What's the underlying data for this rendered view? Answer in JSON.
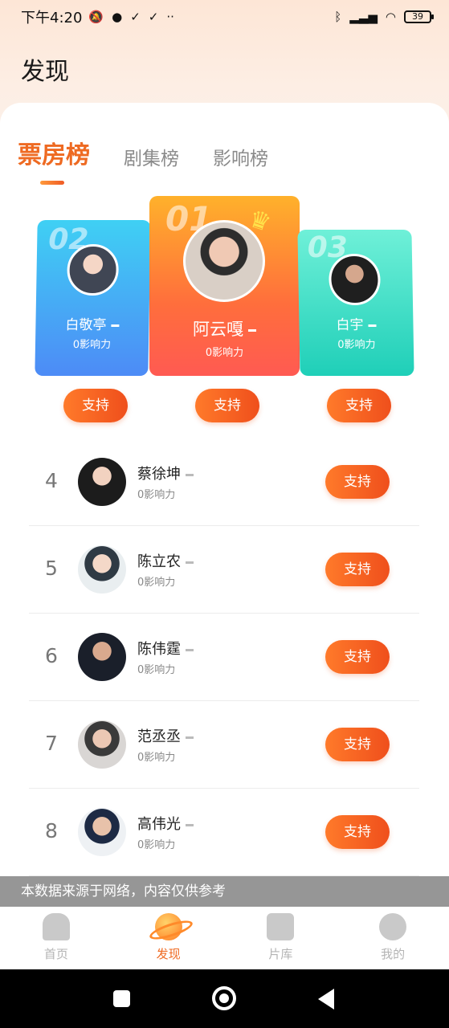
{
  "status_bar": {
    "time": "下午4:20",
    "battery": "39",
    "left_icons": [
      "mute-icon",
      "chat-icon",
      "check-icon",
      "check-icon",
      "more-icon"
    ],
    "right_icons": [
      "bluetooth-icon",
      "signal-icon",
      "wifi-icon",
      "battery-icon"
    ]
  },
  "page_title": "发现",
  "tabs": [
    {
      "label": "票房榜",
      "active": true
    },
    {
      "label": "剧集榜",
      "active": false
    },
    {
      "label": "影响榜",
      "active": false
    }
  ],
  "podium": [
    {
      "rank": "01",
      "name": "阿云嘎",
      "score": "0影响力",
      "support": "支持"
    },
    {
      "rank": "02",
      "name": "白敬亭",
      "score": "0影响力",
      "support": "支持"
    },
    {
      "rank": "03",
      "name": "白宇",
      "score": "0影响力",
      "support": "支持"
    }
  ],
  "list": [
    {
      "rank": "4",
      "name": "蔡徐坤",
      "score": "0影响力",
      "support": "支持"
    },
    {
      "rank": "5",
      "name": "陈立农",
      "score": "0影响力",
      "support": "支持"
    },
    {
      "rank": "6",
      "name": "陈伟霆",
      "score": "0影响力",
      "support": "支持"
    },
    {
      "rank": "7",
      "name": "范丞丞",
      "score": "0影响力",
      "support": "支持"
    },
    {
      "rank": "8",
      "name": "高伟光",
      "score": "0影响力",
      "support": "支持"
    }
  ],
  "disclaimer": "本数据来源于网络，内容仅供参考",
  "bottom_nav": [
    {
      "label": "首页",
      "icon": "home-icon",
      "active": false
    },
    {
      "label": "发现",
      "icon": "planet-icon",
      "active": true
    },
    {
      "label": "片库",
      "icon": "clipboard-icon",
      "active": false
    },
    {
      "label": "我的",
      "icon": "profile-icon",
      "active": false
    }
  ],
  "colors": {
    "accent": "#ee6a22",
    "first_card": "#ff7a3a",
    "second_card": "#4d9df6",
    "third_card": "#2fd7bf"
  }
}
